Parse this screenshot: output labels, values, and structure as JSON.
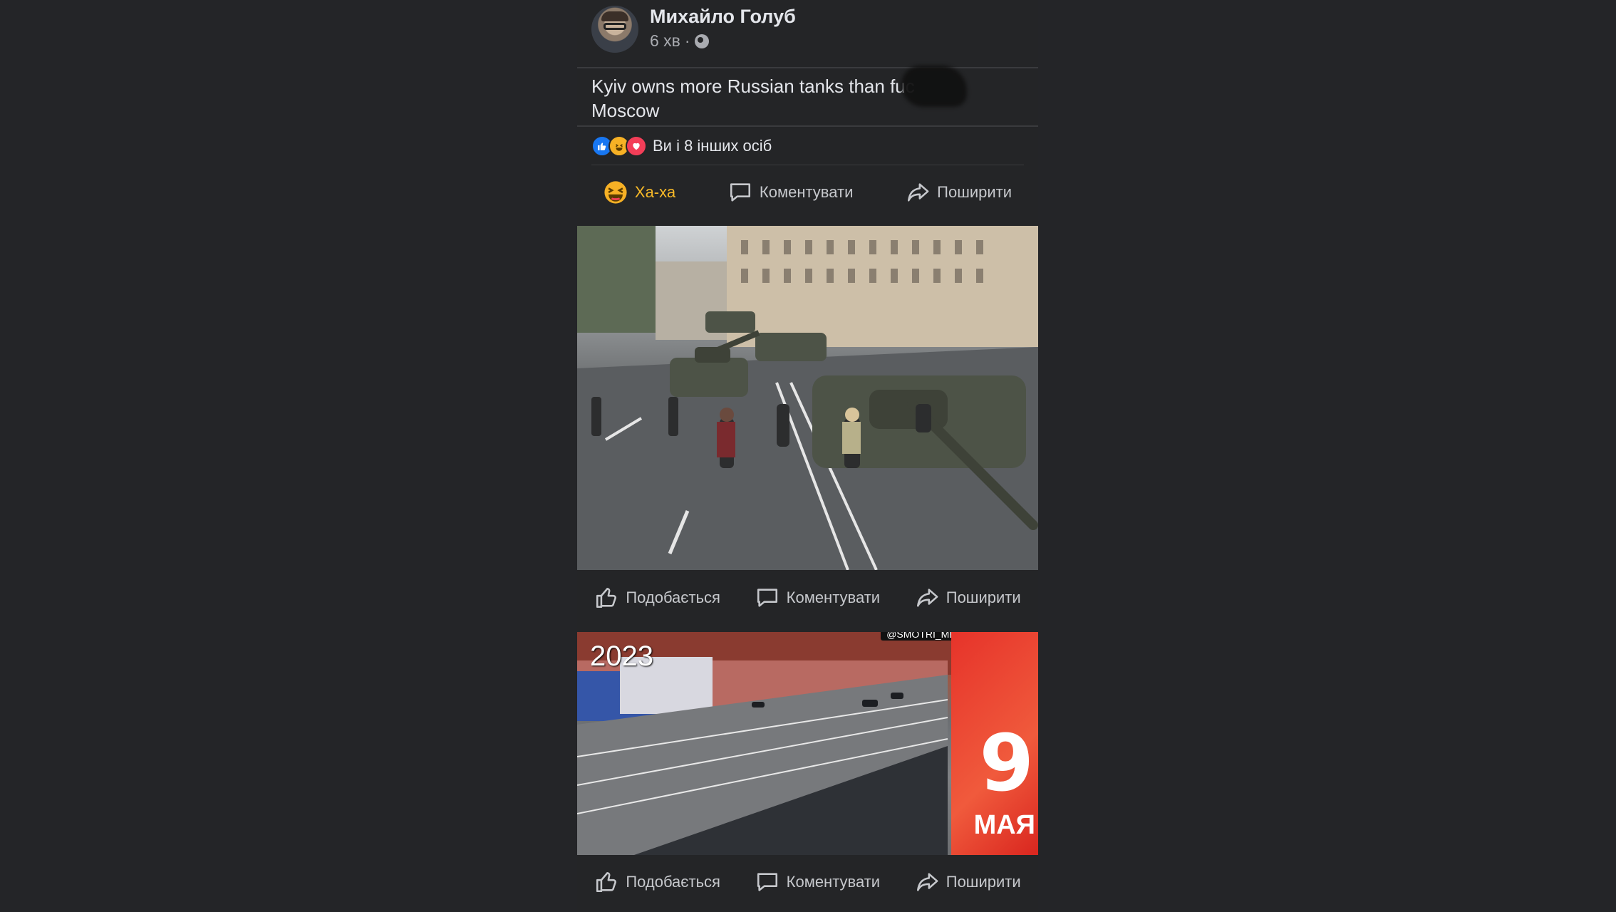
{
  "post": {
    "author": "Михайло Голуб",
    "time": "6 хв",
    "separator": "·",
    "text": "Kyiv owns more Russian tanks than fuc",
    "text_line2": "Moscow",
    "reactions_summary": "Ви і 8 інших осіб"
  },
  "actions_main": {
    "haha": "Ха-ха",
    "comment": "Коментувати",
    "share": "Поширити"
  },
  "actions_photo1": {
    "like": "Подобається",
    "comment": "Коментувати",
    "share": "Поширити"
  },
  "actions_photo2": {
    "like": "Подобається",
    "comment": "Коментувати",
    "share": "Поширити"
  },
  "photo2": {
    "year": "2023",
    "watermark": "@SMOTRI_MEDIA",
    "banner_number": "9",
    "banner_word": "МАЯ"
  },
  "icons": {
    "globe": "globe-icon",
    "like": "thumbs-up-icon",
    "comment": "comment-icon",
    "share": "share-icon",
    "haha": "haha-emoji-icon"
  },
  "colors": {
    "background": "#242528",
    "active_reaction": "#f7b928",
    "like_blue": "#1877f2",
    "love_red": "#f33e58"
  }
}
